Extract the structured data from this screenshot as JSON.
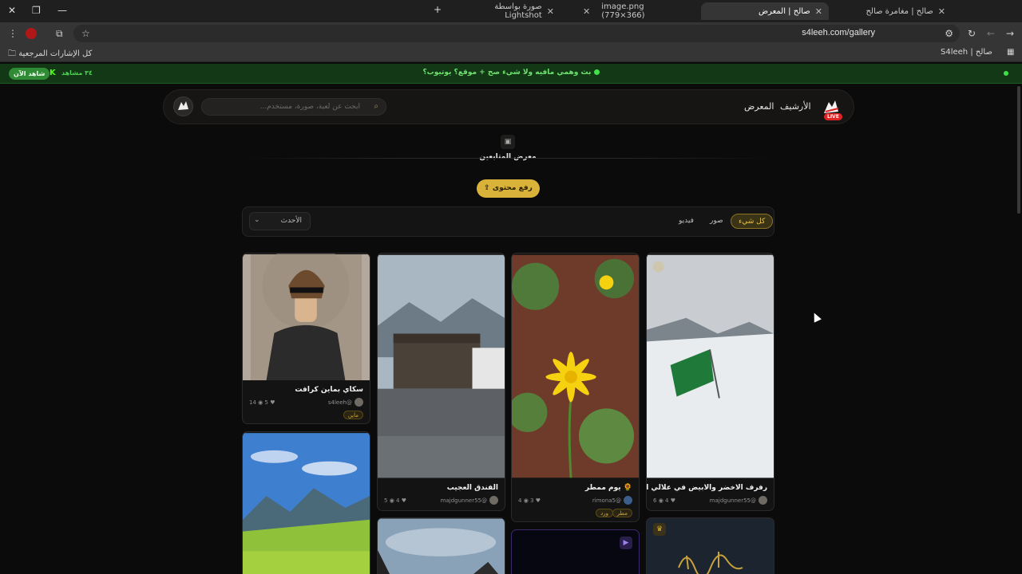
{
  "browser": {
    "tabs": [
      {
        "title": "صالح | مغامرة صالح"
      },
      {
        "title": "صالح | المعرض"
      },
      {
        "title": "image.png (779×366)"
      },
      {
        "title": "صورة بواسطة Lightshot"
      }
    ],
    "new_tab": "+",
    "url": "s4leeh.com/gallery",
    "bookmarks": {
      "all_bookmarks": "كل الإشارات المرجعية",
      "site": "صالح | S4leeh"
    }
  },
  "announcement": {
    "text": "بث وهمي مافيه ولا شيء صح + موقع؟ يوتيوب؟",
    "watch_label": "شاهد الآن",
    "kick_letter": "K",
    "viewers": "٣٤ مشاهد"
  },
  "nav": {
    "live": "LIVE",
    "archive": "الأرشيف",
    "gallery": "المعرض",
    "search_placeholder": "ابحث عن لعبة، صورة، مستخدم..."
  },
  "gallery": {
    "title": "معرض المتابعين",
    "upload_label": "رفع محتوى",
    "filters": [
      "كل شيء",
      "صور",
      "فيديو"
    ],
    "sort": "الأحدث"
  },
  "cards": [
    {
      "title": "سكاي بماين كرافت",
      "user": "s4leeh@",
      "likes": "5",
      "views": "14",
      "tag": "ماين"
    },
    {
      "title": "الفندق العجيب",
      "user": "majdgunner55@",
      "likes": "4",
      "views": "5"
    },
    {
      "title": "يوم ممطر",
      "user": "rimona5@",
      "likes": "3",
      "views": "4",
      "tags": [
        "مطر",
        "ورد"
      ]
    },
    {
      "title": "رفرف الاخضر والابيض في علالي القمم",
      "user": "majdgunner55@",
      "likes": "4",
      "views": "6"
    }
  ],
  "colors": {
    "accent": "#d9b23a",
    "announce_bg": "#123816",
    "live_red": "#e02424",
    "page_bg": "#0b0b0b"
  }
}
